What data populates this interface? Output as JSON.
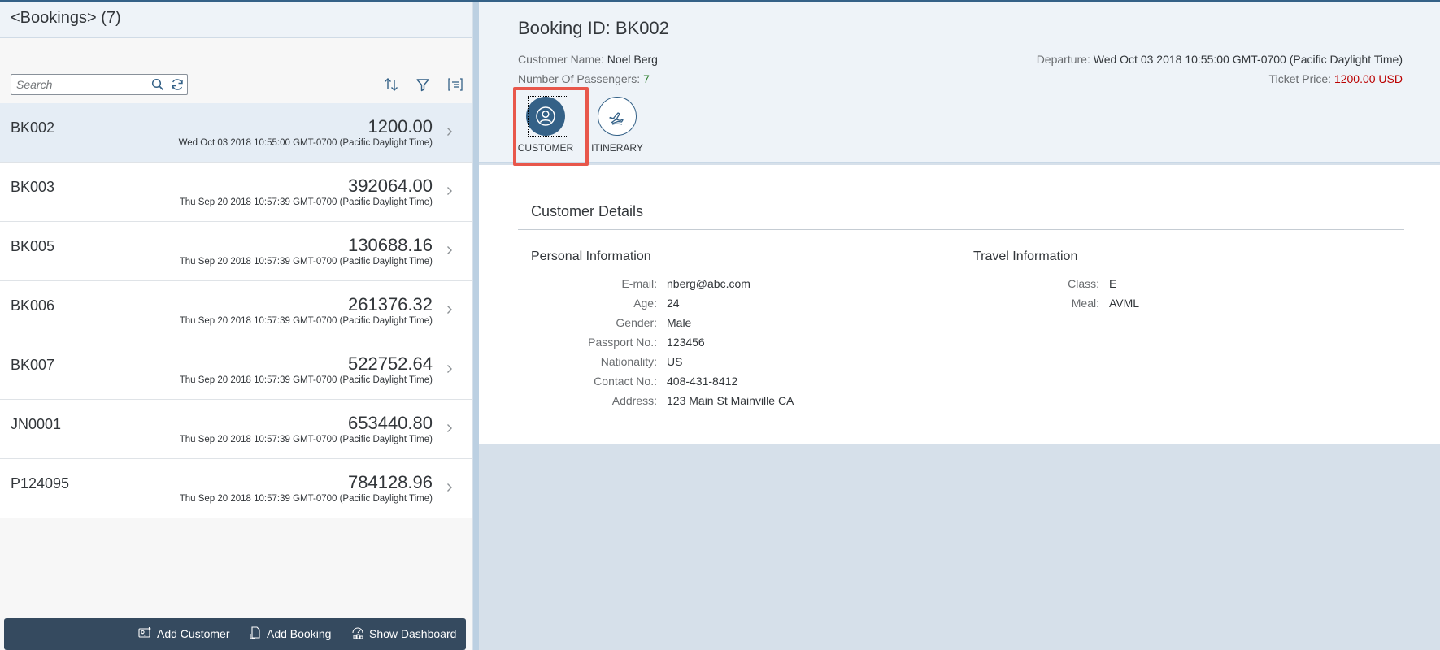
{
  "master": {
    "title": "<Bookings> (7)",
    "search": {
      "placeholder": "Search"
    },
    "bookings": [
      {
        "id": "BK002",
        "amount": "1200.00",
        "date": "Wed Oct 03 2018 10:55:00 GMT-0700 (Pacific Daylight Time)",
        "selected": true
      },
      {
        "id": "BK003",
        "amount": "392064.00",
        "date": "Thu Sep 20 2018 10:57:39 GMT-0700 (Pacific Daylight Time)"
      },
      {
        "id": "BK005",
        "amount": "130688.16",
        "date": "Thu Sep 20 2018 10:57:39 GMT-0700 (Pacific Daylight Time)"
      },
      {
        "id": "BK006",
        "amount": "261376.32",
        "date": "Thu Sep 20 2018 10:57:39 GMT-0700 (Pacific Daylight Time)"
      },
      {
        "id": "BK007",
        "amount": "522752.64",
        "date": "Thu Sep 20 2018 10:57:39 GMT-0700 (Pacific Daylight Time)"
      },
      {
        "id": "JN0001",
        "amount": "653440.80",
        "date": "Thu Sep 20 2018 10:57:39 GMT-0700 (Pacific Daylight Time)"
      },
      {
        "id": "P124095",
        "amount": "784128.96",
        "date": "Thu Sep 20 2018 10:57:39 GMT-0700 (Pacific Daylight Time)"
      }
    ],
    "footer": {
      "add_customer": "Add Customer",
      "add_booking": "Add Booking",
      "show_dashboard": "Show Dashboard"
    }
  },
  "detail": {
    "title": "Booking ID: BK002",
    "customer_name_label": "Customer Name:",
    "customer_name": "Noel Berg",
    "passengers_label": "Number Of Passengers:",
    "passengers": "7",
    "departure_label": "Departure:",
    "departure": "Wed Oct 03 2018 10:55:00 GMT-0700 (Pacific Daylight Time)",
    "ticket_price_label": "Ticket Price:",
    "ticket_price": "1200.00 USD",
    "tabs": {
      "customer": "CUSTOMER",
      "itinerary": "ITINERARY"
    },
    "section_title": "Customer Details",
    "personal": {
      "title": "Personal Information",
      "fields": [
        {
          "label": "E-mail:",
          "value": "nberg@abc.com"
        },
        {
          "label": "Age:",
          "value": "24"
        },
        {
          "label": "Gender:",
          "value": "Male"
        },
        {
          "label": "Passport No.:",
          "value": "123456"
        },
        {
          "label": "Nationality:",
          "value": "US"
        },
        {
          "label": "Contact No.:",
          "value": "408-431-8412"
        },
        {
          "label": "Address:",
          "value": "123 Main St Mainville CA"
        }
      ]
    },
    "travel": {
      "title": "Travel Information",
      "fields": [
        {
          "label": "Class:",
          "value": "E"
        },
        {
          "label": "Meal:",
          "value": "AVML"
        }
      ]
    }
  },
  "colors": {
    "accent": "#346187",
    "footer_bg": "#354a5f",
    "highlight": "#e8574b",
    "price_red": "#bb0000",
    "passenger_green": "#2b7d2b"
  },
  "icons": {
    "search": "search-icon",
    "refresh": "refresh-icon",
    "sort": "sort-icon",
    "filter": "filter-icon",
    "group": "group-icon",
    "chevron": "chevron-right-icon",
    "customer": "person-icon",
    "itinerary": "airplane-icon"
  }
}
